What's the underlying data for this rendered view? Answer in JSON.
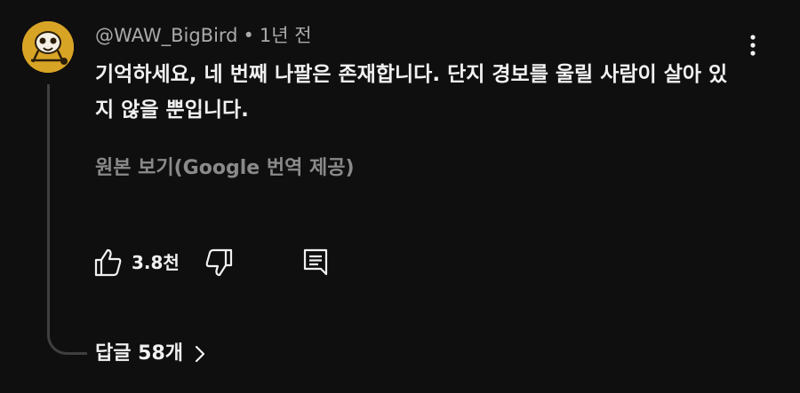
{
  "comment": {
    "author": "@WAW_BigBird",
    "separator": "•",
    "time": "1년 전",
    "text": "기억하세요, 네 번째 나팔은 존재합니다. 단지 경보를 울릴 사람이 살아 있지 않을 뿐입니다.",
    "translation_link": "원본 보기(Google 번역 제공)",
    "like_count": "3.8천",
    "replies_label": "답글 58개"
  },
  "icons": {
    "avatar": "bird-avatar",
    "more": "more-vertical-icon",
    "like": "thumbs-up-icon",
    "dislike": "thumbs-down-icon",
    "reply": "reply-comment-icon",
    "expand": "chevron-right-icon"
  },
  "colors": {
    "background": "#0f0f0f",
    "primary_text": "#f1f1f1",
    "secondary_text": "#aaaaaa",
    "translate_text": "#8a8a8a",
    "avatar_bg": "#d8a426",
    "thread_line": "#3f3f3f"
  }
}
